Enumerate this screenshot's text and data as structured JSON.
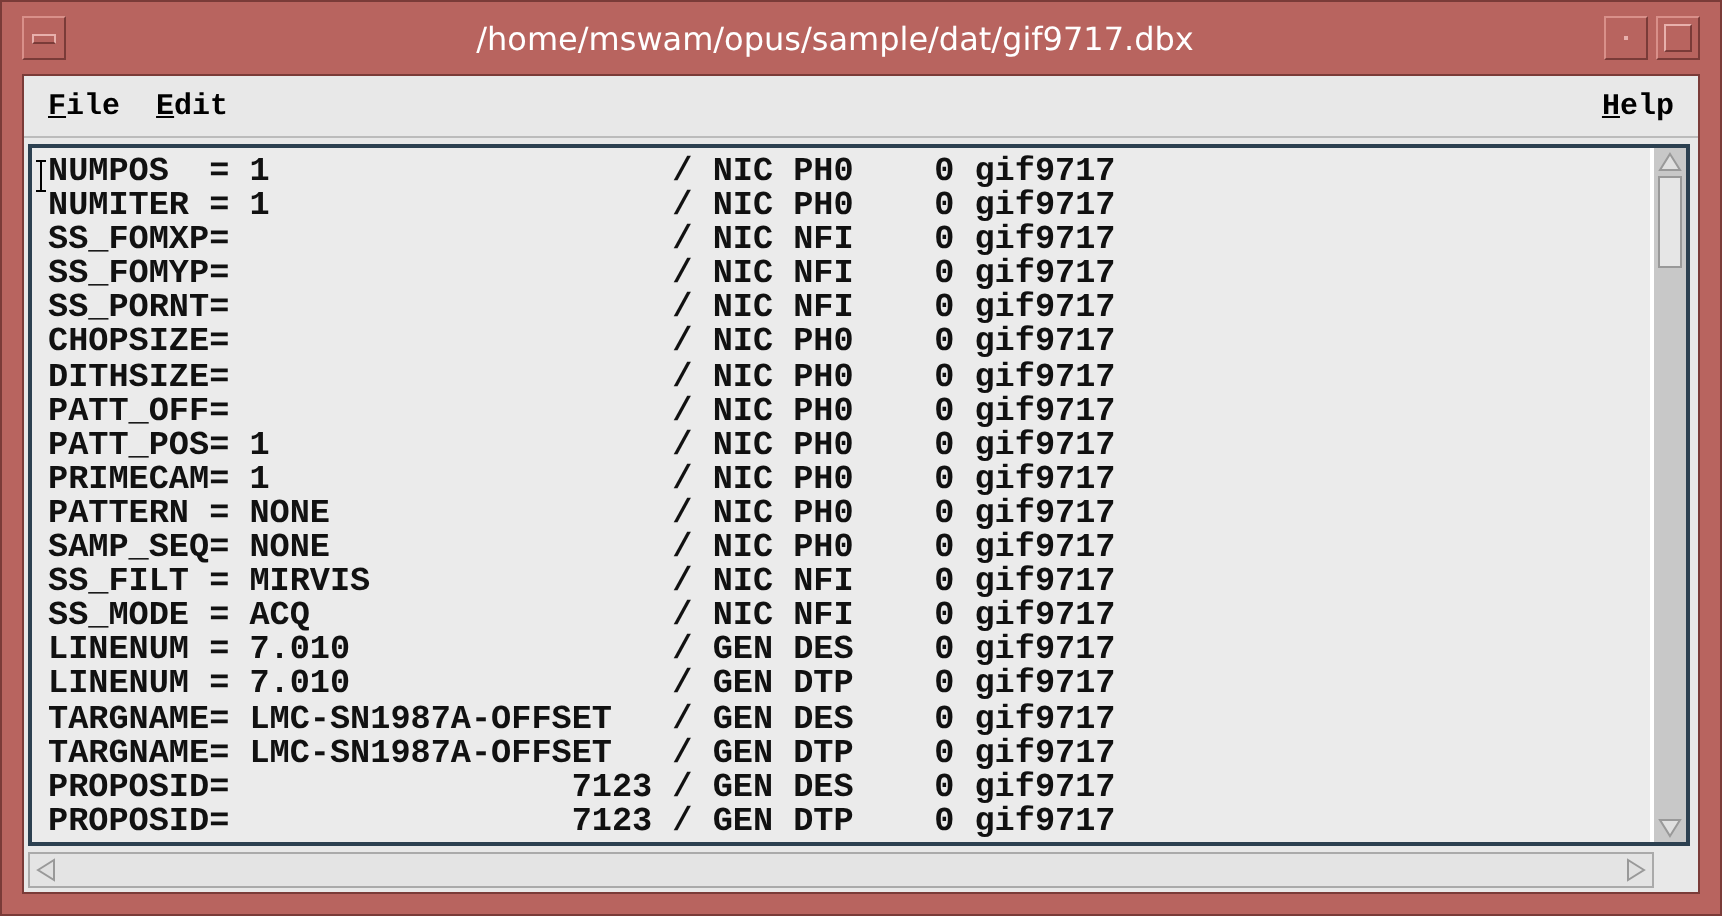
{
  "window": {
    "title": "/home/mswam/opus/sample/dat/gif9717.dbx"
  },
  "menu_left": [
    "File",
    "Edit"
  ],
  "menu_right": [
    "Help"
  ],
  "text_lines": [
    "NUMPOS  = 1                    / NIC PH0    0 gif9717",
    "NUMITER = 1                    / NIC PH0    0 gif9717",
    "SS_FOMXP=                      / NIC NFI    0 gif9717",
    "SS_FOMYP=                      / NIC NFI    0 gif9717",
    "SS_PORNT=                      / NIC NFI    0 gif9717",
    "CHOPSIZE=                      / NIC PH0    0 gif9717",
    "DITHSIZE=                      / NIC PH0    0 gif9717",
    "PATT_OFF=                      / NIC PH0    0 gif9717",
    "PATT_POS= 1                    / NIC PH0    0 gif9717",
    "PRIMECAM= 1                    / NIC PH0    0 gif9717",
    "PATTERN = NONE                 / NIC PH0    0 gif9717",
    "SAMP_SEQ= NONE                 / NIC PH0    0 gif9717",
    "SS_FILT = MIRVIS               / NIC NFI    0 gif9717",
    "SS_MODE = ACQ                  / NIC NFI    0 gif9717",
    "LINENUM = 7.010                / GEN DES    0 gif9717",
    "LINENUM = 7.010                / GEN DTP    0 gif9717",
    "TARGNAME= LMC-SN1987A-OFFSET   / GEN DES    0 gif9717",
    "TARGNAME= LMC-SN1987A-OFFSET   / GEN DTP    0 gif9717",
    "PROPOSID=                 7123 / GEN DES    0 gif9717",
    "PROPOSID=                 7123 / GEN DTP    0 gif9717"
  ]
}
